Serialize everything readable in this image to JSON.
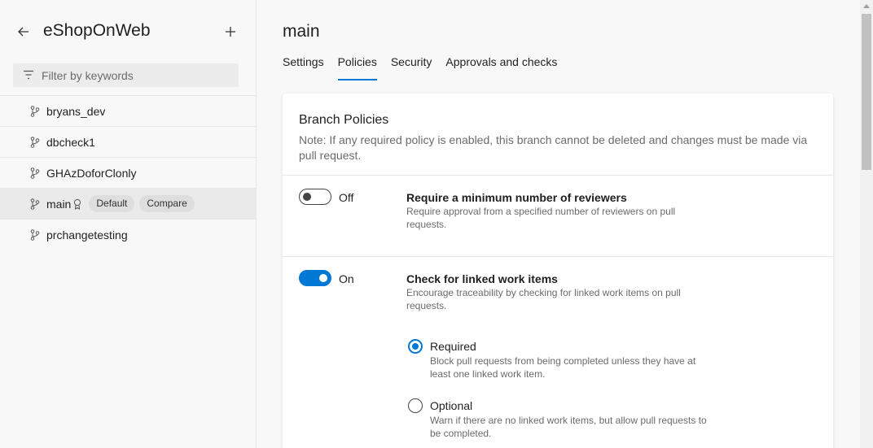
{
  "sidebar": {
    "title": "eShopOnWeb",
    "filter_placeholder": "Filter by keywords",
    "branches": [
      {
        "name": "bryans_dev"
      },
      {
        "name": "dbcheck1"
      },
      {
        "name": "GHAzDoforClonly"
      },
      {
        "name": "main",
        "badges": [
          "Default",
          "Compare"
        ]
      },
      {
        "name": "prchangetesting"
      }
    ]
  },
  "main": {
    "title": "main",
    "tabs": [
      {
        "label": "Settings"
      },
      {
        "label": "Policies"
      },
      {
        "label": "Security"
      },
      {
        "label": "Approvals and checks"
      }
    ],
    "active_tab": "Policies",
    "card": {
      "title": "Branch Policies",
      "note": "Note: If any required policy is enabled, this branch cannot be deleted and changes must be made via pull request.",
      "policies": [
        {
          "toggle_state": "Off",
          "title": "Require a minimum number of reviewers",
          "description": "Require approval from a specified number of reviewers on pull requests."
        },
        {
          "toggle_state": "On",
          "title": "Check for linked work items",
          "description": "Encourage traceability by checking for linked work items on pull requests.",
          "options": [
            {
              "label": "Required",
              "description": "Block pull requests from being completed unless they have at least one linked work item.",
              "checked": true
            },
            {
              "label": "Optional",
              "description": "Warn if there are no linked work items, but allow pull requests to be completed.",
              "checked": false
            }
          ]
        }
      ]
    }
  },
  "colors": {
    "accent": "#0078d4",
    "sidebar_bg": "#f8f8f8",
    "selected_row": "#eaeaea"
  }
}
